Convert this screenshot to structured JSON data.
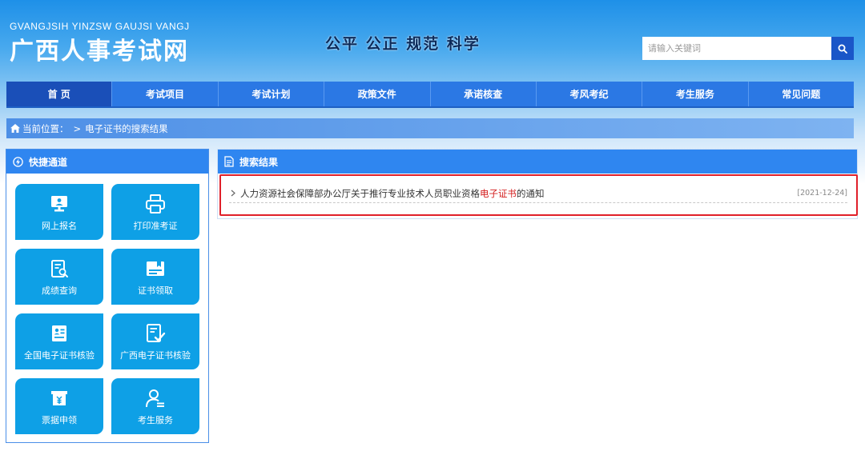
{
  "header": {
    "logo_pinyin": "GVANGJSIH YINZSW GAUJSI VANGJ",
    "logo_cn": "广西人事考试网",
    "slogan": "公平 公正 规范 科学"
  },
  "search": {
    "placeholder": "请输入关键词",
    "icon": "search-icon"
  },
  "nav": {
    "items": [
      {
        "label": "首 页"
      },
      {
        "label": "考试项目"
      },
      {
        "label": "考试计划"
      },
      {
        "label": "政策文件"
      },
      {
        "label": "承诺核查"
      },
      {
        "label": "考风考纪"
      },
      {
        "label": "考生服务"
      },
      {
        "label": "常见问题"
      }
    ]
  },
  "breadcrumb": {
    "prefix": "当前位置：",
    "separator": ">",
    "current": "电子证书的搜索结果"
  },
  "sidebar": {
    "title": "快捷通道",
    "tiles": [
      {
        "label": "网上报名",
        "icon": "monitor-icon"
      },
      {
        "label": "打印准考证",
        "icon": "printer-icon"
      },
      {
        "label": "成绩查询",
        "icon": "score-query-icon"
      },
      {
        "label": "证书领取",
        "icon": "certificate-icon"
      },
      {
        "label": "全国电子证书核验",
        "icon": "id-card-icon"
      },
      {
        "label": "广西电子证书核验",
        "icon": "verify-document-icon"
      },
      {
        "label": "票据申领",
        "icon": "receipt-icon"
      },
      {
        "label": "考生服务",
        "icon": "user-service-icon"
      }
    ]
  },
  "results": {
    "title": "搜索结果",
    "items": [
      {
        "pre": "人力资源社会保障部办公厅关于推行专业技术人员职业资格",
        "highlight": "电子证书",
        "post": "的通知",
        "date": "[2021-12-24]"
      }
    ]
  },
  "colors": {
    "nav_bg": "#2b78e4",
    "nav_active": "#1a4fb8",
    "tile_bg": "#0ea0e6",
    "panel_head": "#2f86f0",
    "highlight": "#d42020",
    "annotation_box": "#e0202a"
  }
}
